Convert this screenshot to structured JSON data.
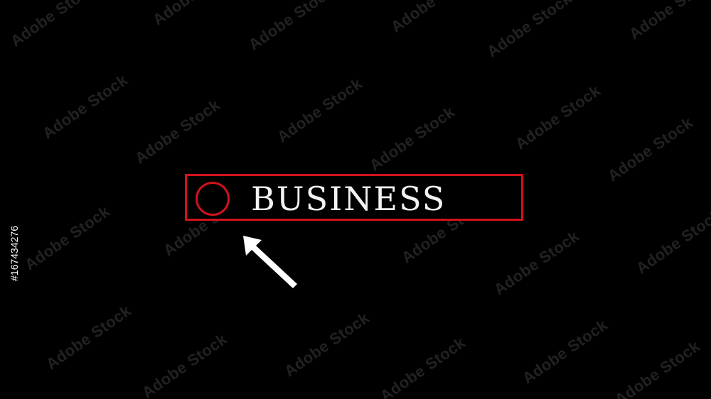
{
  "search": {
    "query": "BUSINESS"
  },
  "watermark": {
    "text": "Adobe Stock"
  },
  "stock_id": "#167434276",
  "colors": {
    "background": "#000000",
    "accent": "#d0121b",
    "text": "#f2f2f2"
  },
  "icons": {
    "cursor": "arrow-cursor-icon",
    "search_indicator": "circle-icon"
  }
}
